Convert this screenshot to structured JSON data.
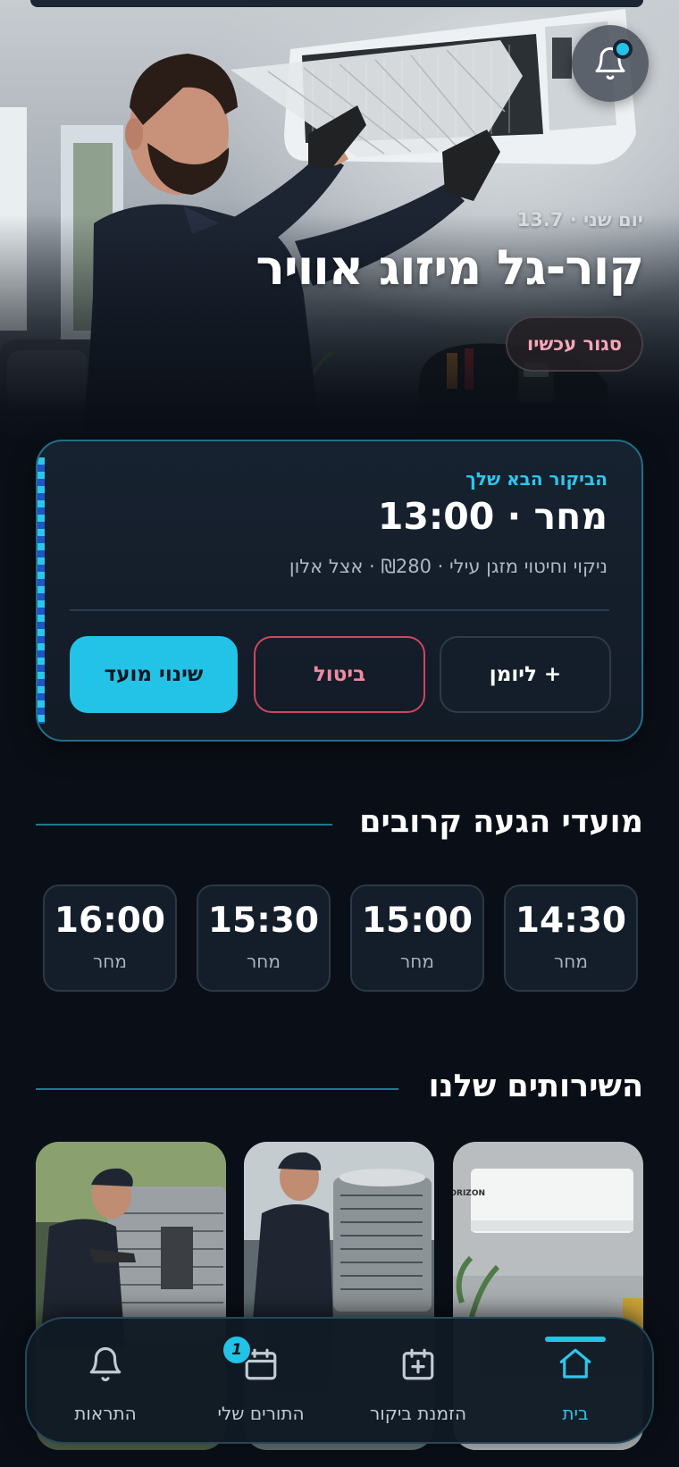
{
  "hero": {
    "date": "יום שני · 13.7",
    "title": "קור-גל מיזוג אוויר",
    "status": "סגור עכשיו",
    "notifications_icon": "bell-icon"
  },
  "next_visit": {
    "label": "הביקור הבא שלך",
    "when": "מחר · 13:00",
    "description": "ניקוי וחיטוי מזגן עילי · ₪280 · אצל אלון",
    "buttons": {
      "reschedule": "שינוי מועד",
      "cancel": "ביטול",
      "calendar": "+ ליומן"
    }
  },
  "arrival": {
    "title": "מועדי הגעה קרובים",
    "slots": [
      {
        "time": "14:30",
        "day": "מחר"
      },
      {
        "time": "15:00",
        "day": "מחר"
      },
      {
        "time": "15:30",
        "day": "מחר"
      },
      {
        "time": "16:00",
        "day": "מחר"
      }
    ]
  },
  "services": {
    "title": "השירותים שלנו",
    "brand_on_unit": "HORIZON"
  },
  "nav": {
    "items": [
      {
        "label": "בית",
        "icon": "home-icon"
      },
      {
        "label": "הזמנת ביקור",
        "icon": "calendar-plus-icon"
      },
      {
        "label": "התורים שלי",
        "icon": "calendar-icon",
        "badge": "1"
      },
      {
        "label": "התראות",
        "icon": "bell-icon"
      }
    ]
  },
  "colors": {
    "accent": "#22c3e6",
    "background": "#0a0f17",
    "danger": "#d0465f"
  }
}
